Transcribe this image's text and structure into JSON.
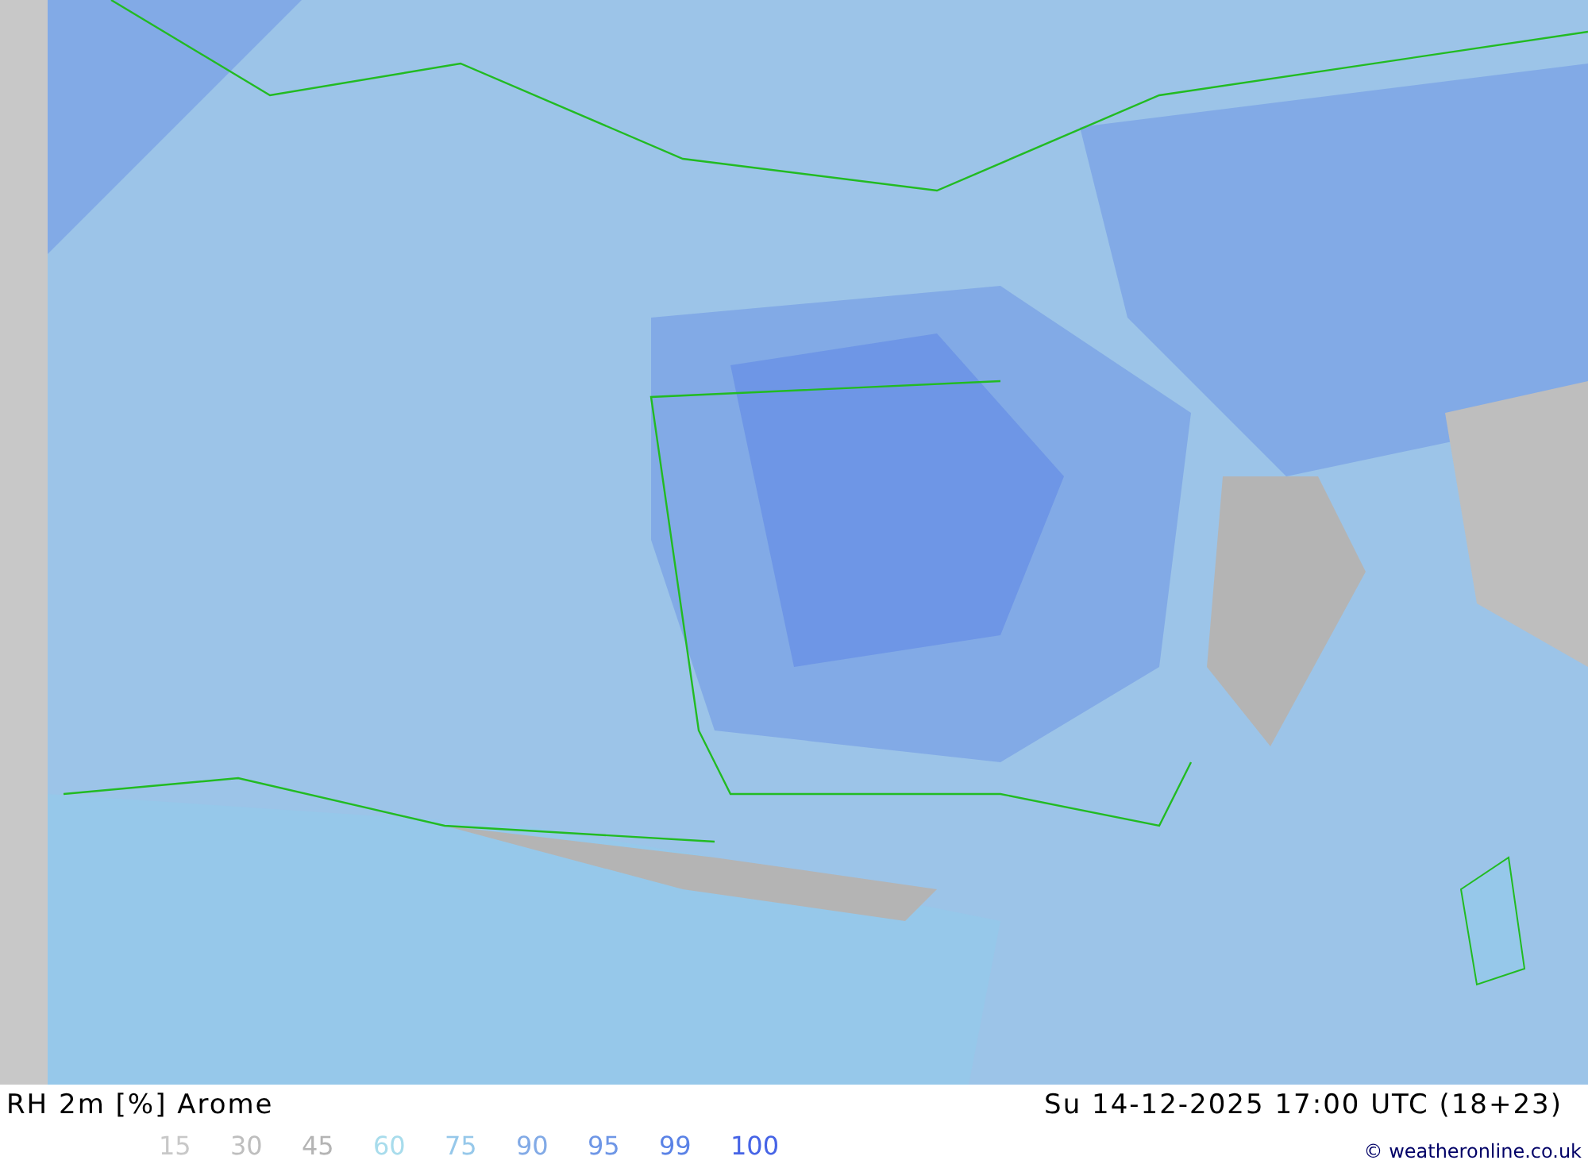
{
  "map": {
    "title": "RH 2m [%] Arome",
    "valid_time": "Su 14-12-2025 17:00 UTC (18+23)"
  },
  "legend": [
    {
      "label": "15",
      "color": "#c8c8c8"
    },
    {
      "label": "30",
      "color": "#bebebe"
    },
    {
      "label": "45",
      "color": "#b4b4b4"
    },
    {
      "label": "60",
      "color": "#a8dcec"
    },
    {
      "label": "75",
      "color": "#96c8ea"
    },
    {
      "label": "90",
      "color": "#82aae6"
    },
    {
      "label": "95",
      "color": "#6e96e6"
    },
    {
      "label": "99",
      "color": "#5a82e6"
    },
    {
      "label": "100",
      "color": "#4664e6"
    }
  ],
  "credit": "© weatheronline.co.uk"
}
